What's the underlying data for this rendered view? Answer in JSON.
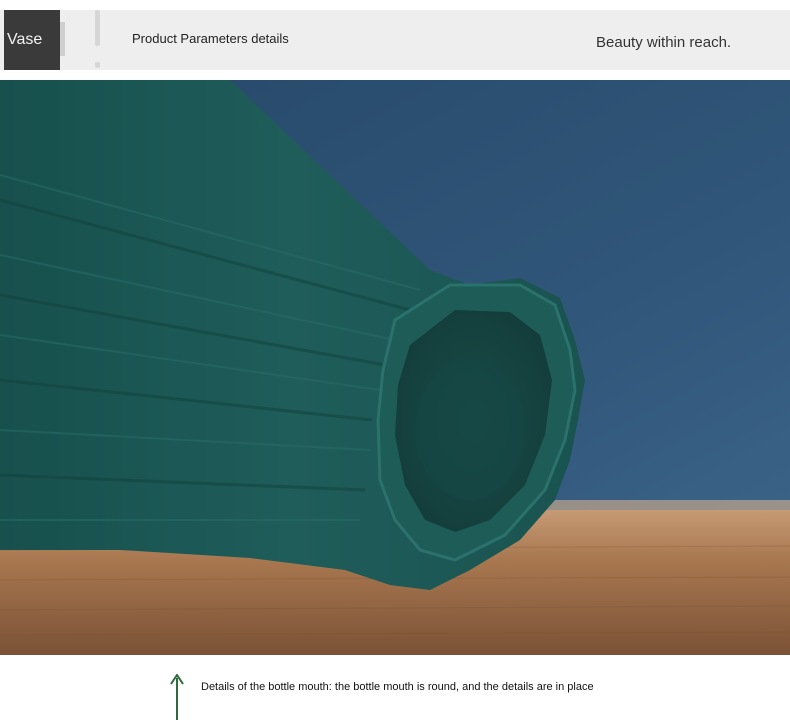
{
  "header": {
    "tag": "Vase",
    "title": "Product Parameters details",
    "slogan": "Beauty within reach."
  },
  "photo": {
    "subject": "vase-mouth-photo",
    "colors": {
      "vase": "#1f5a57",
      "wall": "#2e5274",
      "table": "#9a6a48"
    }
  },
  "caption": {
    "text": "Details of the bottle mouth: the bottle mouth is round, and the details are in place",
    "arrow_color": "#2f6a3a"
  }
}
